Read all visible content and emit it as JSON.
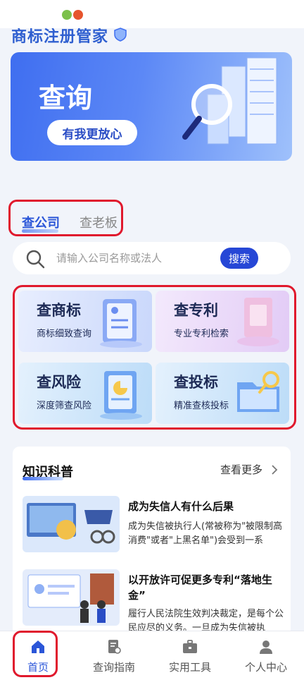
{
  "brand": {
    "title": "商标注册管家"
  },
  "banner": {
    "title": "查询",
    "button_label": "有我更放心"
  },
  "tabs": [
    {
      "label": "查公司",
      "active": true
    },
    {
      "label": "查老板",
      "active": false
    }
  ],
  "search": {
    "placeholder": "请输入公司名称或法人",
    "button_label": "搜索"
  },
  "services": [
    {
      "title": "查商标",
      "subtitle": "商标细致查询"
    },
    {
      "title": "查专利",
      "subtitle": "专业专利检索"
    },
    {
      "title": "查风险",
      "subtitle": "深度筛查风险"
    },
    {
      "title": "查投标",
      "subtitle": "精准查核投标"
    }
  ],
  "knowledge": {
    "title": "知识科普",
    "more_label": "查看更多",
    "articles": [
      {
        "title": "成为失信人有什么后果",
        "desc": "成为失信被执行人(常被称为\"被限制高消费\"或者\"上黑名单\")会受到一系"
      },
      {
        "title": "以开放许可促更多专利“落地生金”",
        "desc": "履行人民法院生效判决裁定，是每个公民应尽的义务。一旦成为失信被执"
      }
    ]
  },
  "bottom_nav": [
    {
      "label": "首页",
      "icon": "home-icon",
      "active": true
    },
    {
      "label": "查询指南",
      "icon": "guide-icon",
      "active": false
    },
    {
      "label": "实用工具",
      "icon": "toolbox-icon",
      "active": false
    },
    {
      "label": "个人中心",
      "icon": "user-icon",
      "active": false
    }
  ],
  "colors": {
    "accent": "#2647d6",
    "highlight": "#e0192d",
    "banner": "#4a78f2"
  }
}
